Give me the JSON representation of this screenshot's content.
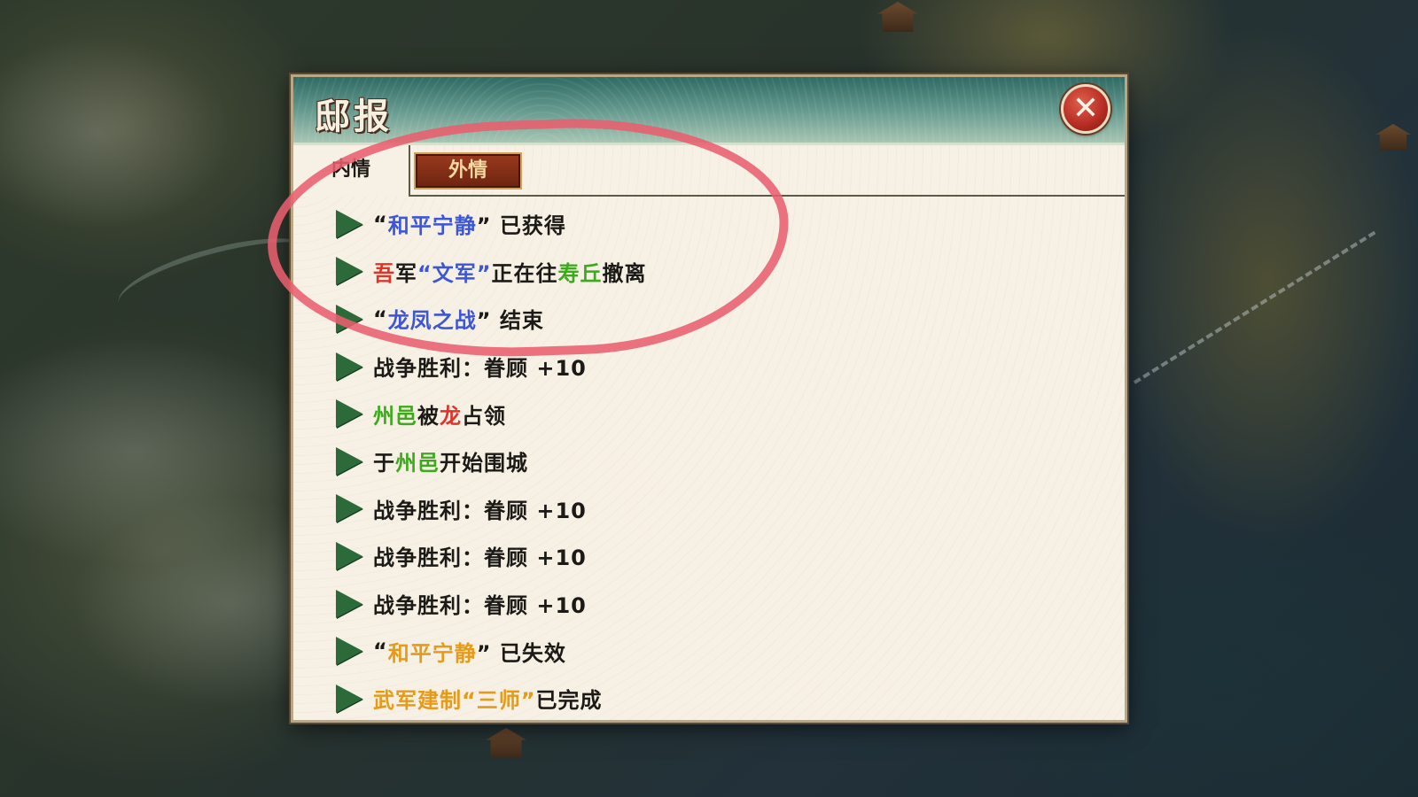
{
  "dialog": {
    "title": "邸报",
    "close_symbol": "✕"
  },
  "tabs": [
    {
      "label": "内情",
      "active": true
    },
    {
      "label": "外情",
      "active": false
    }
  ],
  "reports": [
    [
      {
        "text": "“",
        "color": "dark"
      },
      {
        "text": "和平宁静",
        "color": "blue"
      },
      {
        "text": "” 已获得",
        "color": "dark"
      }
    ],
    [
      {
        "text": "吾",
        "color": "red"
      },
      {
        "text": "军 ",
        "color": "dark"
      },
      {
        "text": "“文军”",
        "color": "blue"
      },
      {
        "text": "正在往",
        "color": "dark"
      },
      {
        "text": "寿丘",
        "color": "green"
      },
      {
        "text": "撤离",
        "color": "dark"
      }
    ],
    [
      {
        "text": "“",
        "color": "dark"
      },
      {
        "text": "龙凤之战",
        "color": "blue"
      },
      {
        "text": "” 结束",
        "color": "dark"
      }
    ],
    [
      {
        "text": "战争胜利：眷顾 +10",
        "color": "dark"
      }
    ],
    [
      {
        "text": "州邑",
        "color": "green"
      },
      {
        "text": "被",
        "color": "dark"
      },
      {
        "text": "龙",
        "color": "red"
      },
      {
        "text": "占领",
        "color": "dark"
      }
    ],
    [
      {
        "text": "于",
        "color": "dark"
      },
      {
        "text": "州邑",
        "color": "green"
      },
      {
        "text": "开始围城",
        "color": "dark"
      }
    ],
    [
      {
        "text": "战争胜利：眷顾 +10",
        "color": "dark"
      }
    ],
    [
      {
        "text": "战争胜利：眷顾 +10",
        "color": "dark"
      }
    ],
    [
      {
        "text": "战争胜利：眷顾 +10",
        "color": "dark"
      }
    ],
    [
      {
        "text": "“",
        "color": "dark"
      },
      {
        "text": "和平宁静",
        "color": "gold"
      },
      {
        "text": "” 已失效",
        "color": "dark"
      }
    ],
    [
      {
        "text": "武军建制 ",
        "color": "gold"
      },
      {
        "text": "“三师”",
        "color": "gold"
      },
      {
        "text": "已完成",
        "color": "dark"
      }
    ]
  ],
  "colors": {
    "blue": "#3c56d6",
    "red": "#e0332a",
    "green": "#3caa1c",
    "gold": "#e59a1a",
    "dark": "#1c1a16",
    "arrow": "#2c6a3a",
    "annotation": "#e85e6e"
  },
  "annotation": {
    "shape": "hand-drawn circle",
    "covers_reports": 3
  }
}
